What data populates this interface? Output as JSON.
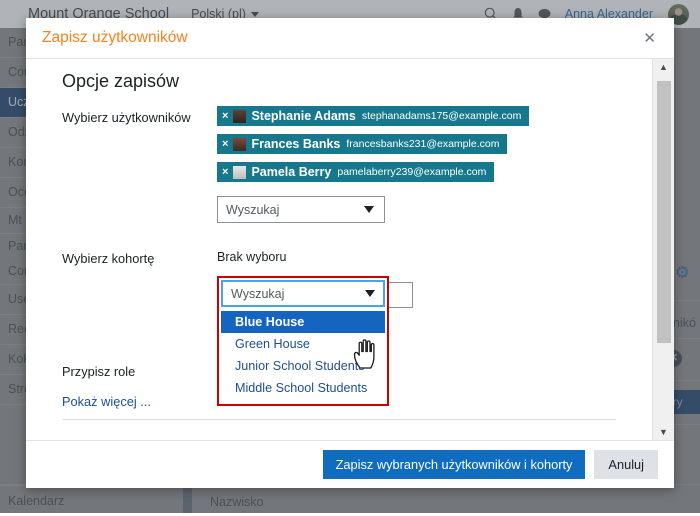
{
  "navbar": {
    "brand": "Mount Orange School",
    "language": "Polski (pl)",
    "search_icon": "search-icon",
    "notifications_icon": "bell-icon",
    "messages_icon": "message-icon",
    "user_name": "Anna Alexander"
  },
  "sidebar": {
    "items": [
      {
        "label": "Pare",
        "active": false
      },
      {
        "label": "Cour",
        "active": false
      },
      {
        "label": "Ucze",
        "active": true
      },
      {
        "label": "Odzn",
        "active": false
      },
      {
        "label": "Komp",
        "active": false
      },
      {
        "label": "Ocen",
        "active": false
      },
      {
        "label": "Mt O",
        "active": false
      },
      {
        "label": "Pare",
        "active": false
      },
      {
        "label": "Cour",
        "active": false
      },
      {
        "label": "Usef",
        "active": false
      },
      {
        "label": "Reco",
        "active": false
      },
      {
        "label": "Kokp",
        "active": false
      },
      {
        "label": "Stron",
        "active": false
      }
    ],
    "bottom_item": "Kalendarz"
  },
  "background": {
    "gear_icon": "gear-icon",
    "users_label": "wnikó",
    "clear_icon": "clear-circle-icon",
    "filter_button": "uj filtry",
    "table_header": "Nazwisko"
  },
  "modal": {
    "title": "Zapisz użytkowników",
    "close_label": "✕",
    "section_title": "Opcje zapisów",
    "labels": {
      "select_users": "Wybierz użytkowników",
      "select_cohort": "Wybierz kohortę",
      "assign_role": "Przypisz role"
    },
    "selected_users": [
      {
        "remove": "×",
        "name": "Stephanie Adams",
        "email": "stephanadams175@example.com",
        "avatar": "user-avatar-icon"
      },
      {
        "remove": "×",
        "name": "Frances Banks",
        "email": "francesbanks231@example.com",
        "avatar": "user-avatar-icon"
      },
      {
        "remove": "×",
        "name": "Pamela Berry",
        "email": "pamelaberry239@example.com",
        "avatar": "user-avatar-icon"
      }
    ],
    "user_search": {
      "value": "Wyszukaj",
      "caret_icon": "chevron-down-icon"
    },
    "cohort_no_selection": "Brak wyboru",
    "cohort_search": {
      "value": "Wyszukaj",
      "caret_icon": "chevron-down-icon"
    },
    "cohort_options": [
      {
        "label": "Blue House",
        "selected": true
      },
      {
        "label": "Green House",
        "selected": false
      },
      {
        "label": "Junior School Students",
        "selected": false
      },
      {
        "label": "Middle School Students",
        "selected": false
      }
    ],
    "show_more": "Pokaż więcej ...",
    "footer": {
      "submit": "Zapisz wybranych użytkowników i kohorty",
      "cancel": "Anuluj"
    },
    "scrollbar": {
      "up_icon": "caret-up-icon",
      "down_icon": "caret-down-icon"
    }
  },
  "colors": {
    "accent_orange": "#f5821f",
    "tag_teal": "#17788d",
    "primary_blue": "#0f6cbf",
    "highlight_blue": "#1565c0",
    "focus_red": "#cc0000",
    "link_blue": "#1d4f91"
  }
}
